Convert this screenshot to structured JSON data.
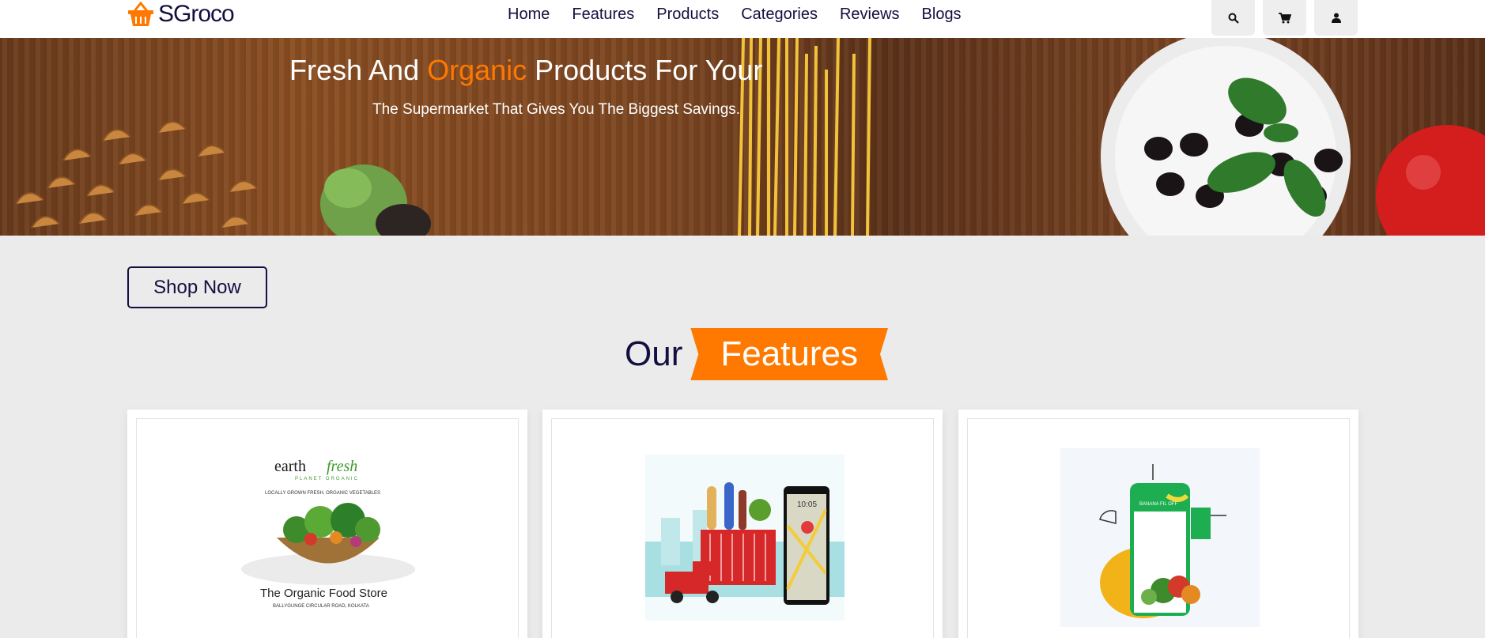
{
  "header": {
    "logo_text": "SGroco",
    "nav": [
      "Home",
      "Features",
      "Products",
      "Categories",
      "Reviews",
      "Blogs"
    ],
    "icons": [
      "search-icon",
      "cart-icon",
      "user-icon"
    ]
  },
  "banner": {
    "title_before": "Fresh And ",
    "title_highlight": "Organic",
    "title_after": " Products For Your",
    "subtitle": "The Supermarket That Gives You The Biggest Savings."
  },
  "shop_button": "Shop Now",
  "features": {
    "heading_our": "Our",
    "heading_features": "Features",
    "card1": {
      "brand_a": "earth",
      "brand_b": "fresh",
      "tag": "PLANET ORGANIC",
      "small": "LOCALLY GROWN FRESH, ORGANIC VEGETABLES",
      "store": "The Organic Food Store",
      "address": "BALLYGUNGE CIRCULAR ROAD, KOLKATA"
    },
    "card2": {
      "phone_time": "10:05"
    },
    "card3": {
      "app_text": "BANANA FIL OFF"
    }
  },
  "colors": {
    "accent": "#ff7800",
    "navy": "#130f40",
    "background": "#ebebeb"
  }
}
